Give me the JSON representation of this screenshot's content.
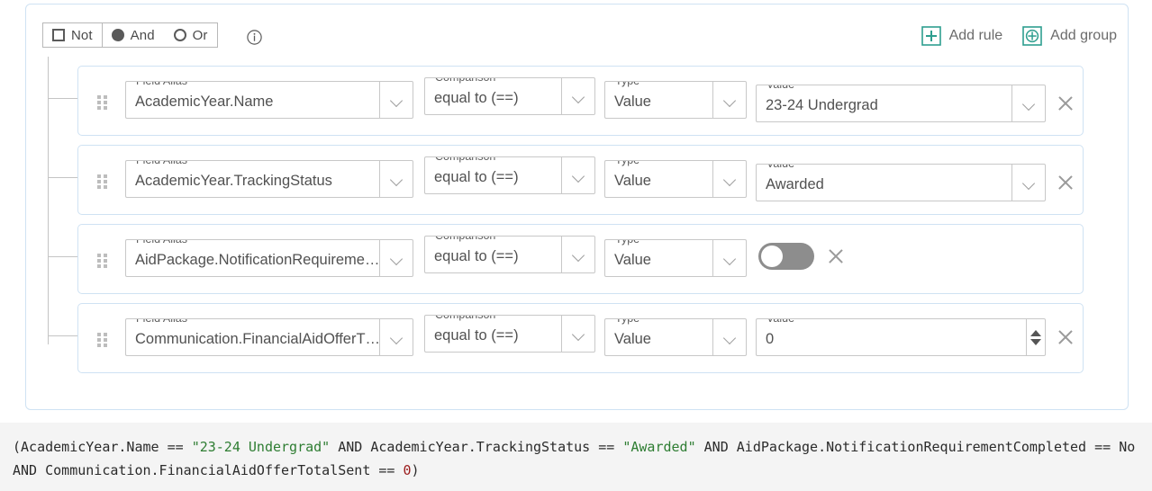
{
  "query_builder": {
    "logic": {
      "not_label": "Not",
      "not_checked": false,
      "and_label": "And",
      "or_label": "Or",
      "selected": "And"
    },
    "info_icon": "info-circle-icon",
    "actions": {
      "add_rule_label": "Add rule",
      "add_rule_icon": "plus-square-icon",
      "add_group_label": "Add group",
      "add_group_icon": "plus-circle-square-icon",
      "accent_color": "#2e9e8f"
    },
    "labels": {
      "field_alias": "Field Alias",
      "comparison": "Comparison",
      "type": "Type",
      "value": "Value",
      "required_mark": "*",
      "required_color": "#d0394e"
    },
    "rules": [
      {
        "field_alias": "AcademicYear.Name",
        "comparison": "equal to (==)",
        "type": "Value",
        "value_control": "select",
        "value": "23-24 Undergrad",
        "removable": true
      },
      {
        "field_alias": "AcademicYear.TrackingStatus",
        "comparison": "equal to (==)",
        "type": "Value",
        "value_control": "select",
        "value": "Awarded",
        "removable": true
      },
      {
        "field_alias": "AidPackage.NotificationRequireme…",
        "comparison": "equal to (==)",
        "type": "Value",
        "value_control": "toggle",
        "value": "No",
        "toggle_on": false,
        "removable": true
      },
      {
        "field_alias": "Communication.FinancialAidOfferT…",
        "comparison": "equal to (==)",
        "type": "Value",
        "value_control": "number",
        "value": "0",
        "removable": true
      }
    ]
  },
  "expression": {
    "line1_prefix": "(AcademicYear.Name == ",
    "line1_str1": "\"23-24 Undergrad\"",
    "line1_mid1": " AND AcademicYear.TrackingStatus == ",
    "line1_str2": "\"Awarded\"",
    "line1_mid2": " AND AidPackage.NotificationRequirementCompleted == No",
    "line2_prefix": "AND Communication.FinancialAidOfferTotalSent == ",
    "line2_num": "0",
    "line2_suffix": ")",
    "string_color": "#2e7d32",
    "number_color": "#9b1c1c"
  }
}
